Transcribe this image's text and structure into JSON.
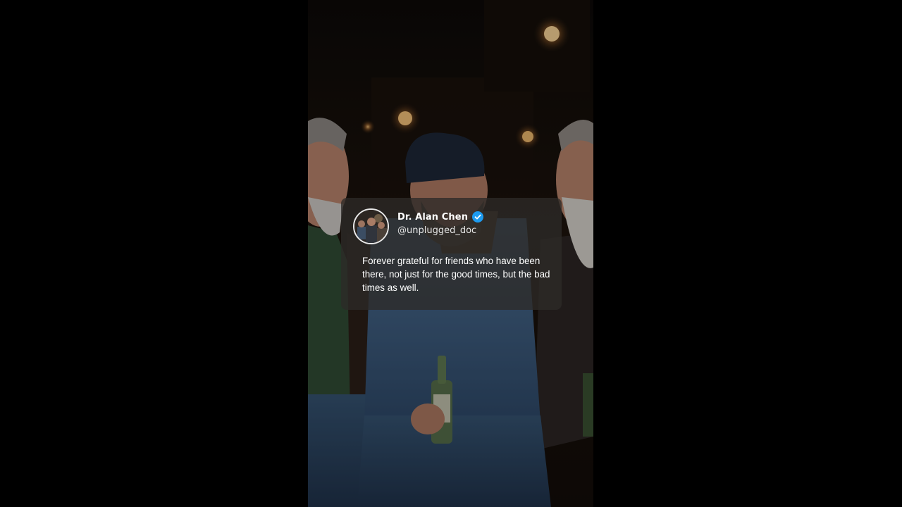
{
  "tweet": {
    "display_name": "Dr. Alan Chen",
    "handle": "@unplugged_doc",
    "text": "Forever grateful for friends who have been there, not just for the good times, but the bad times as well.",
    "verified": true,
    "verified_icon": "verified-check-icon",
    "avatar_icon": "profile-photo"
  },
  "colors": {
    "page_background": "#000000",
    "card_background": "rgba(45,42,40,0.78)",
    "verified_badge": "#1d9bf0",
    "text_primary": "#ffffff"
  }
}
